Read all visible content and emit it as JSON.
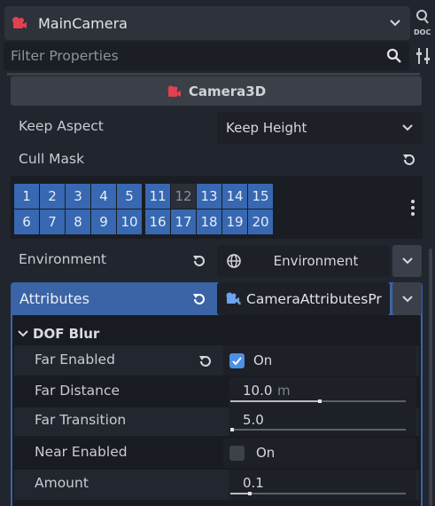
{
  "node_selector": {
    "name": "MainCamera",
    "icon": "camera-icon"
  },
  "filter": {
    "placeholder": "Filter Properties"
  },
  "class_header": {
    "label": "Camera3D",
    "icon": "camera-3d-icon"
  },
  "properties": {
    "keep_aspect": {
      "label": "Keep Aspect",
      "value": "Keep Height"
    },
    "cull_mask": {
      "label": "Cull Mask",
      "layers_row1": [
        "1",
        "2",
        "3",
        "4",
        "5",
        "11",
        "12",
        "13",
        "14",
        "15"
      ],
      "layers_row2": [
        "6",
        "7",
        "8",
        "9",
        "10",
        "16",
        "17",
        "18",
        "19",
        "20"
      ],
      "disabled_layers": [
        "12"
      ]
    },
    "environment": {
      "label": "Environment",
      "value": "Environment"
    },
    "attributes": {
      "label": "Attributes",
      "value": "CameraAttributesPr"
    }
  },
  "dof_blur": {
    "title": "DOF Blur",
    "far_enabled": {
      "label": "Far Enabled",
      "checked": true,
      "value": "On"
    },
    "far_distance": {
      "label": "Far Distance",
      "value": "10.0",
      "unit": "m",
      "slider_fraction": 0.5
    },
    "far_transition": {
      "label": "Far Transition",
      "value": "5.0",
      "slider_fraction": 0.0
    },
    "near_enabled": {
      "label": "Near Enabled",
      "checked": false,
      "value": "On"
    },
    "amount": {
      "label": "Amount",
      "value": "0.1",
      "slider_fraction": 0.1
    }
  },
  "colors": {
    "accent": "#3a64a6",
    "layer_on": "#3768b1",
    "node_icon": "#e0414f"
  }
}
